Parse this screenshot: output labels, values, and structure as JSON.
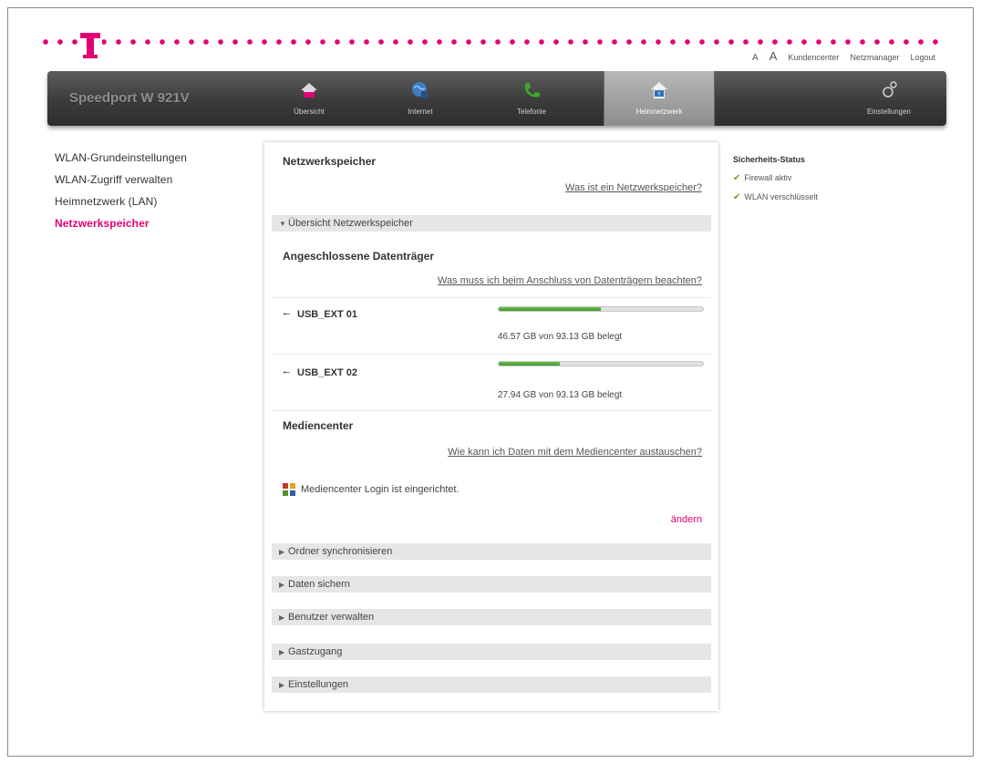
{
  "top_links": {
    "a_small": "A",
    "a_large": "A",
    "kundencenter": "Kundencenter",
    "netzmanager": "Netzmanager",
    "logout": "Logout"
  },
  "nav": {
    "product": "Speedport W 921V",
    "tabs": [
      {
        "label": "Übersicht",
        "icon": "home-icon"
      },
      {
        "label": "Internet",
        "icon": "globe-icon"
      },
      {
        "label": "Telefonie",
        "icon": "phone-icon"
      },
      {
        "label": "Heimnetzwerk",
        "icon": "network-icon",
        "active": true
      },
      {
        "label": "Einstellungen",
        "icon": "settings-icon"
      }
    ]
  },
  "sidebar": {
    "items": [
      {
        "label": "WLAN-Grundeinstellungen"
      },
      {
        "label": "WLAN-Zugriff verwalten"
      },
      {
        "label": "Heimnetzwerk (LAN)"
      },
      {
        "label": "Netzwerkspeicher",
        "active": true
      }
    ]
  },
  "main": {
    "title": "Netzwerkspeicher",
    "help_link": "Was ist ein Netzwerkspeicher?",
    "overview_label": "Übersicht Netzwerkspeicher",
    "devices_title": "Angeschlossene Datenträger",
    "devices_link": "Was muss ich beim Anschluss von Datenträgern beachten?",
    "devices": [
      {
        "name": "USB_EXT 01",
        "usage": "46.57 GB von 93.13 GB belegt",
        "fill": 0.5
      },
      {
        "name": "USB_EXT 02",
        "usage": "27.94 GB von 93.13 GB belegt",
        "fill": 0.3
      }
    ],
    "media_title": "Mediencenter",
    "media_link": "Wie kann ich Daten mit dem Mediencenter austauschen?",
    "media_status": "Mediencenter Login ist eingerichtet.",
    "change_link": "ändern",
    "sections": [
      {
        "label": "Ordner synchronisieren"
      },
      {
        "label": "Daten sichern"
      },
      {
        "label": "Benutzer verwalten"
      },
      {
        "label": "Gastzugang"
      },
      {
        "label": "Einstellungen"
      }
    ]
  },
  "status": {
    "title": "Sicherheits-Status",
    "items": [
      {
        "label": "Firewall aktiv"
      },
      {
        "label": "WLAN verschlüsselt"
      }
    ]
  },
  "colors": {
    "brand": "#e20074",
    "progress": "#4ea833"
  }
}
